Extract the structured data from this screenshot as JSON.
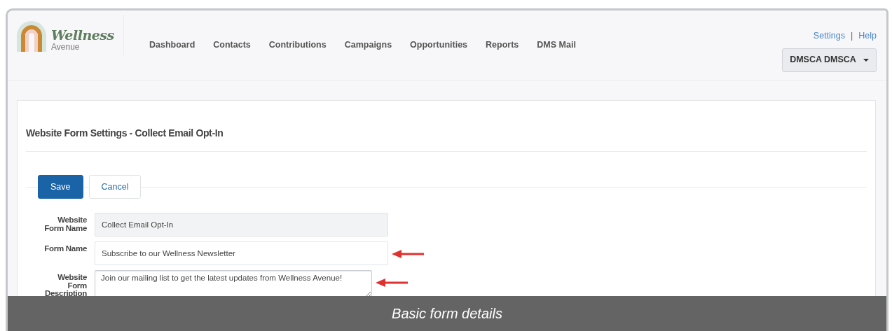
{
  "logo": {
    "title": "Wellness",
    "subtitle": "Avenue"
  },
  "nav": [
    {
      "label": "Dashboard"
    },
    {
      "label": "Contacts"
    },
    {
      "label": "Contributions"
    },
    {
      "label": "Campaigns"
    },
    {
      "label": "Opportunities"
    },
    {
      "label": "Reports"
    },
    {
      "label": "DMS Mail"
    }
  ],
  "top_links": {
    "settings": "Settings",
    "separator": "|",
    "help": "Help"
  },
  "user_menu": {
    "label": "DMSCA DMSCA"
  },
  "heading": "Website Form Settings - Collect Email Opt-In",
  "buttons": [
    {
      "label": "Save",
      "kind": "primary"
    },
    {
      "label": "Cancel",
      "kind": "secondary"
    }
  ],
  "fields": [
    {
      "label": "Website Form Name",
      "value": "Collect Email Opt-In",
      "kind": "input",
      "disabled": true,
      "annotated": false
    },
    {
      "label": "Form Name",
      "value": "Subscribe to our Wellness Newsletter",
      "kind": "input",
      "disabled": false,
      "annotated": true
    },
    {
      "label": "Website Form Description",
      "value": "Join our mailing list to get the latest updates from Wellness Avenue!",
      "kind": "textarea",
      "disabled": false,
      "annotated": true
    }
  ],
  "caption": "Basic form details"
}
